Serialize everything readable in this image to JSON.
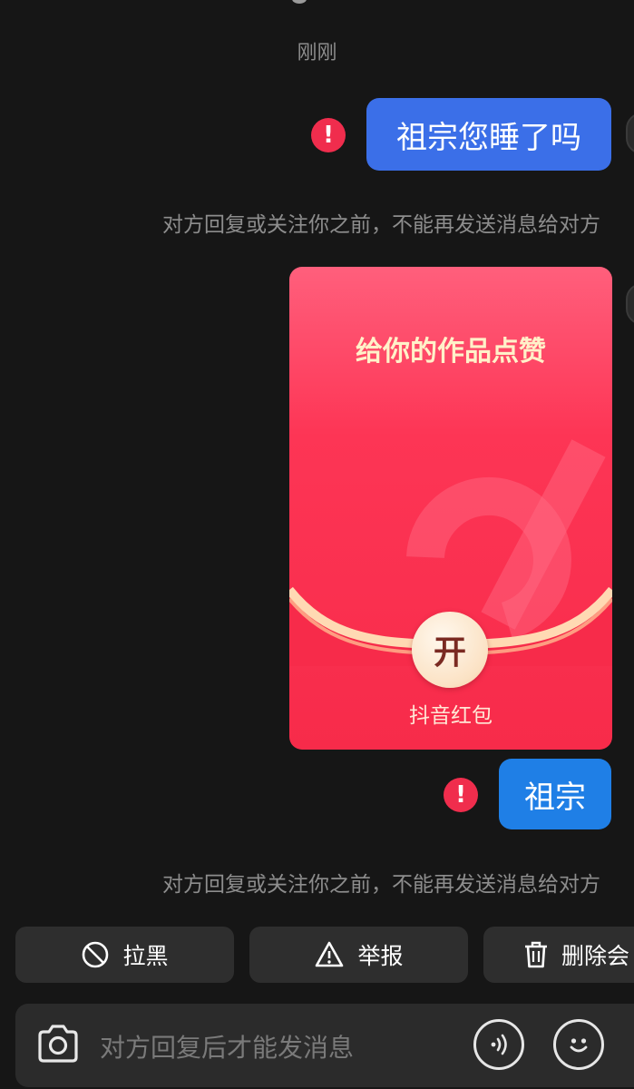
{
  "chat": {
    "timestamp": "刚刚",
    "messages": [
      {
        "text": "祖宗您睡了吗",
        "status": "failed"
      },
      {
        "text": "祖宗",
        "status": "failed"
      }
    ],
    "notices": [
      "对方回复或关注你之前，不能再发送消息给对方",
      "对方回复或关注你之前，不能再发送消息给对方"
    ],
    "red_envelope": {
      "title": "给你的作品点赞",
      "open_label": "开",
      "brand": "抖音红包"
    },
    "error_mark": "!"
  },
  "actions": {
    "block_label": "拉黑",
    "report_label": "举报",
    "delete_label": "删除会"
  },
  "input": {
    "placeholder": "对方回复后才能发消息"
  },
  "colors": {
    "background": "#161616",
    "bubble_blue": "#3b6fe8",
    "bubble_blue_2": "#1f7fe6",
    "error_red": "#f02d4d",
    "envelope_red": "#f72b4a"
  },
  "icons": [
    "block-icon",
    "warning-icon",
    "trash-icon",
    "camera-icon",
    "voice-icon",
    "emoji-icon"
  ]
}
